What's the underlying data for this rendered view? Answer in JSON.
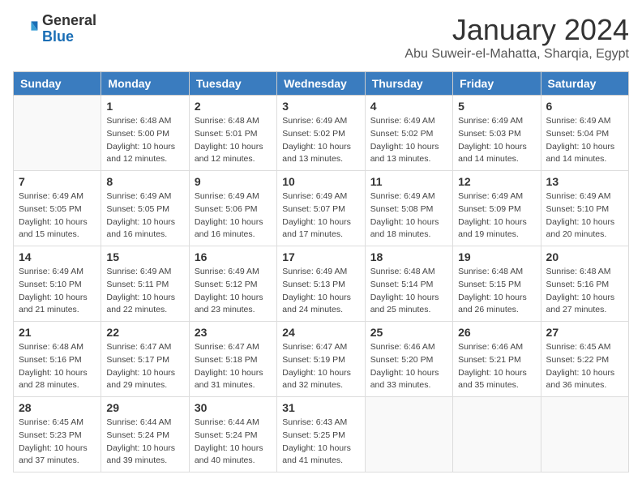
{
  "header": {
    "logo_general": "General",
    "logo_blue": "Blue",
    "month_title": "January 2024",
    "subtitle": "Abu Suweir-el-Mahatta, Sharqia, Egypt"
  },
  "days_of_week": [
    "Sunday",
    "Monday",
    "Tuesday",
    "Wednesday",
    "Thursday",
    "Friday",
    "Saturday"
  ],
  "weeks": [
    [
      {
        "day": "",
        "info": ""
      },
      {
        "day": "1",
        "info": "Sunrise: 6:48 AM\nSunset: 5:00 PM\nDaylight: 10 hours\nand 12 minutes."
      },
      {
        "day": "2",
        "info": "Sunrise: 6:48 AM\nSunset: 5:01 PM\nDaylight: 10 hours\nand 12 minutes."
      },
      {
        "day": "3",
        "info": "Sunrise: 6:49 AM\nSunset: 5:02 PM\nDaylight: 10 hours\nand 13 minutes."
      },
      {
        "day": "4",
        "info": "Sunrise: 6:49 AM\nSunset: 5:02 PM\nDaylight: 10 hours\nand 13 minutes."
      },
      {
        "day": "5",
        "info": "Sunrise: 6:49 AM\nSunset: 5:03 PM\nDaylight: 10 hours\nand 14 minutes."
      },
      {
        "day": "6",
        "info": "Sunrise: 6:49 AM\nSunset: 5:04 PM\nDaylight: 10 hours\nand 14 minutes."
      }
    ],
    [
      {
        "day": "7",
        "info": "Sunrise: 6:49 AM\nSunset: 5:05 PM\nDaylight: 10 hours\nand 15 minutes."
      },
      {
        "day": "8",
        "info": "Sunrise: 6:49 AM\nSunset: 5:05 PM\nDaylight: 10 hours\nand 16 minutes."
      },
      {
        "day": "9",
        "info": "Sunrise: 6:49 AM\nSunset: 5:06 PM\nDaylight: 10 hours\nand 16 minutes."
      },
      {
        "day": "10",
        "info": "Sunrise: 6:49 AM\nSunset: 5:07 PM\nDaylight: 10 hours\nand 17 minutes."
      },
      {
        "day": "11",
        "info": "Sunrise: 6:49 AM\nSunset: 5:08 PM\nDaylight: 10 hours\nand 18 minutes."
      },
      {
        "day": "12",
        "info": "Sunrise: 6:49 AM\nSunset: 5:09 PM\nDaylight: 10 hours\nand 19 minutes."
      },
      {
        "day": "13",
        "info": "Sunrise: 6:49 AM\nSunset: 5:10 PM\nDaylight: 10 hours\nand 20 minutes."
      }
    ],
    [
      {
        "day": "14",
        "info": "Sunrise: 6:49 AM\nSunset: 5:10 PM\nDaylight: 10 hours\nand 21 minutes."
      },
      {
        "day": "15",
        "info": "Sunrise: 6:49 AM\nSunset: 5:11 PM\nDaylight: 10 hours\nand 22 minutes."
      },
      {
        "day": "16",
        "info": "Sunrise: 6:49 AM\nSunset: 5:12 PM\nDaylight: 10 hours\nand 23 minutes."
      },
      {
        "day": "17",
        "info": "Sunrise: 6:49 AM\nSunset: 5:13 PM\nDaylight: 10 hours\nand 24 minutes."
      },
      {
        "day": "18",
        "info": "Sunrise: 6:48 AM\nSunset: 5:14 PM\nDaylight: 10 hours\nand 25 minutes."
      },
      {
        "day": "19",
        "info": "Sunrise: 6:48 AM\nSunset: 5:15 PM\nDaylight: 10 hours\nand 26 minutes."
      },
      {
        "day": "20",
        "info": "Sunrise: 6:48 AM\nSunset: 5:16 PM\nDaylight: 10 hours\nand 27 minutes."
      }
    ],
    [
      {
        "day": "21",
        "info": "Sunrise: 6:48 AM\nSunset: 5:16 PM\nDaylight: 10 hours\nand 28 minutes."
      },
      {
        "day": "22",
        "info": "Sunrise: 6:47 AM\nSunset: 5:17 PM\nDaylight: 10 hours\nand 29 minutes."
      },
      {
        "day": "23",
        "info": "Sunrise: 6:47 AM\nSunset: 5:18 PM\nDaylight: 10 hours\nand 31 minutes."
      },
      {
        "day": "24",
        "info": "Sunrise: 6:47 AM\nSunset: 5:19 PM\nDaylight: 10 hours\nand 32 minutes."
      },
      {
        "day": "25",
        "info": "Sunrise: 6:46 AM\nSunset: 5:20 PM\nDaylight: 10 hours\nand 33 minutes."
      },
      {
        "day": "26",
        "info": "Sunrise: 6:46 AM\nSunset: 5:21 PM\nDaylight: 10 hours\nand 35 minutes."
      },
      {
        "day": "27",
        "info": "Sunrise: 6:45 AM\nSunset: 5:22 PM\nDaylight: 10 hours\nand 36 minutes."
      }
    ],
    [
      {
        "day": "28",
        "info": "Sunrise: 6:45 AM\nSunset: 5:23 PM\nDaylight: 10 hours\nand 37 minutes."
      },
      {
        "day": "29",
        "info": "Sunrise: 6:44 AM\nSunset: 5:24 PM\nDaylight: 10 hours\nand 39 minutes."
      },
      {
        "day": "30",
        "info": "Sunrise: 6:44 AM\nSunset: 5:24 PM\nDaylight: 10 hours\nand 40 minutes."
      },
      {
        "day": "31",
        "info": "Sunrise: 6:43 AM\nSunset: 5:25 PM\nDaylight: 10 hours\nand 41 minutes."
      },
      {
        "day": "",
        "info": ""
      },
      {
        "day": "",
        "info": ""
      },
      {
        "day": "",
        "info": ""
      }
    ]
  ]
}
